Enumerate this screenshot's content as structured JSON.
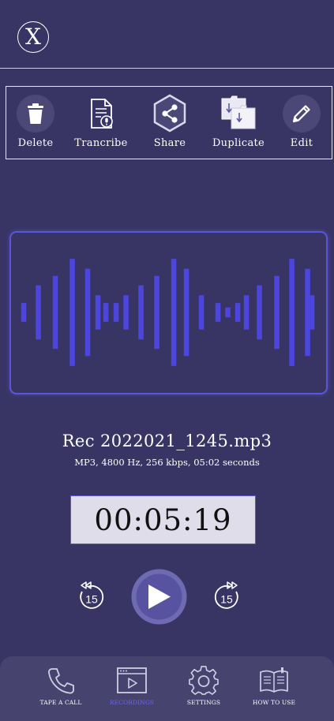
{
  "header": {
    "close_label": "X"
  },
  "toolbar": {
    "items": [
      {
        "label": "Delete",
        "icon": "trash-icon"
      },
      {
        "label": "Trancribe",
        "icon": "transcribe-icon"
      },
      {
        "label": "Share",
        "icon": "share-icon"
      },
      {
        "label": "Duplicate",
        "icon": "duplicate-icon"
      },
      {
        "label": "Edit",
        "icon": "pencil-icon"
      }
    ]
  },
  "waveform": {
    "color": "#4c46df",
    "bar_levels": [
      0.17,
      0.49,
      0.66,
      0.97,
      0.79,
      0.31,
      0.17,
      0.17,
      0.31,
      0.49,
      0.66,
      0.97,
      0.79,
      0.31,
      0.17,
      0.09,
      0.17,
      0.31,
      0.49,
      0.66,
      0.97,
      0.79,
      0.31,
      0.17
    ]
  },
  "recording": {
    "title": "Rec 2022021_1245.mp3",
    "meta": "MP3, 4800 Hz, 256 kbps, 05:02 seconds",
    "elapsed": "00:05:19"
  },
  "controls": {
    "rewind_label": "15",
    "forward_label": "15"
  },
  "nav": {
    "items": [
      {
        "label": "TAPE A CALL",
        "icon": "phone-icon",
        "active": false
      },
      {
        "label": "RECORDINGS",
        "icon": "recordings-icon",
        "active": true
      },
      {
        "label": "SETTINGS",
        "icon": "gear-icon",
        "active": false
      },
      {
        "label": "HOW TO USE",
        "icon": "book-icon",
        "active": false
      }
    ]
  },
  "colors": {
    "background": "#383565",
    "accent": "#5a55d6",
    "active_nav": "#6a66f0"
  }
}
